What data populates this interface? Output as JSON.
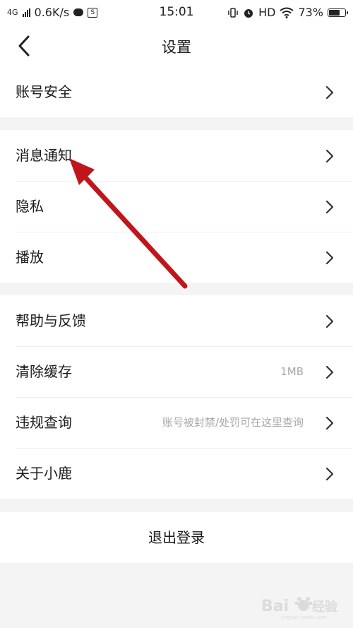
{
  "status_bar": {
    "network": "4G",
    "speed": "0.6K/s",
    "time": "15:01",
    "hd": "HD",
    "battery": "73%",
    "battery_level": 0.73,
    "icons": [
      "signal-icon",
      "chat-icon",
      "s-app-icon",
      "vibrate-icon",
      "alarm-icon",
      "wifi-icon",
      "battery-icon"
    ]
  },
  "header": {
    "title": "设置",
    "back_icon": "chevron-left-icon"
  },
  "groups": [
    {
      "items": [
        {
          "label": "账号安全"
        }
      ]
    },
    {
      "items": [
        {
          "label": "消息通知"
        },
        {
          "label": "隐私"
        },
        {
          "label": "播放"
        }
      ]
    },
    {
      "items": [
        {
          "label": "帮助与反馈"
        },
        {
          "label": "清除缓存",
          "value": "1MB"
        },
        {
          "label": "违规查询",
          "value": "账号被封禁/处罚可在这里查询"
        },
        {
          "label": "关于小鹿"
        }
      ]
    }
  ],
  "logout": {
    "label": "退出登录"
  },
  "annotation": {
    "color": "#c0161b"
  },
  "watermark": {
    "text": "Bai经验",
    "url": "jingyan.baidu.com"
  }
}
